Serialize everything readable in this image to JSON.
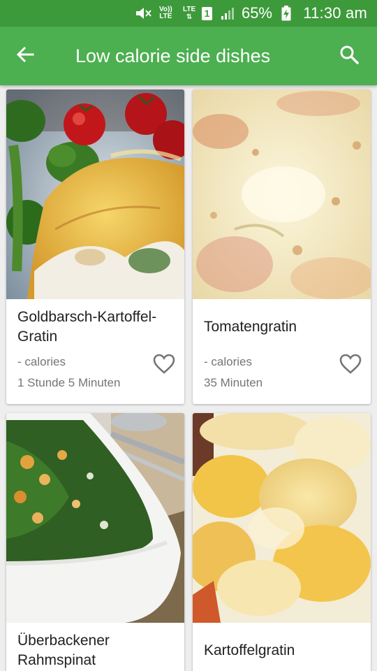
{
  "status_bar": {
    "volte_line1": "Vo))",
    "volte_line2": "LTE",
    "lte_label": "LTE",
    "sim_slot": "1",
    "battery_percent": "65%",
    "time": "11:30 am",
    "icons": [
      "mute-icon",
      "lte-data-icon",
      "signal-icon",
      "battery-charging-icon"
    ]
  },
  "app_bar": {
    "title": "Low calorie side dishes",
    "back_icon": "arrow-left-icon",
    "search_icon": "search-icon",
    "color": "#4caf50",
    "status_color": "#3d9a3a"
  },
  "recipes": [
    {
      "title": "Goldbarsch-Kartoffel-Gratin",
      "calories": "- calories",
      "duration": "1 Stunde 5 Minuten",
      "image": "fish-potato-gratin-photo"
    },
    {
      "title": "Tomatengratin",
      "calories": "- calories",
      "duration": "35 Minuten",
      "image": "tomato-gratin-photo"
    },
    {
      "title": "Überbackener Rahmspinat",
      "image": "creamed-spinach-bake-photo"
    },
    {
      "title": "Kartoffelgratin",
      "image": "potato-gratin-photo"
    }
  ]
}
